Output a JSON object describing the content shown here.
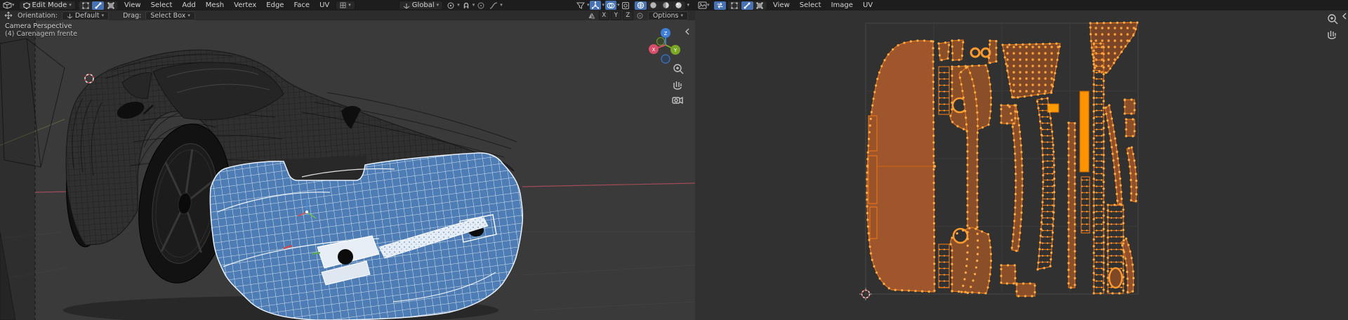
{
  "viewport_3d": {
    "header": {
      "mode_label": "Edit Mode",
      "menus": [
        "View",
        "Select",
        "Add",
        "Mesh",
        "Vertex",
        "Edge",
        "Face",
        "UV"
      ],
      "transform_orientation": "Global"
    },
    "tool_settings": {
      "orientation_label": "Orientation:",
      "orientation_value": "Default",
      "drag_label": "Drag:",
      "drag_value": "Select Box",
      "mirror_x": "X",
      "mirror_y": "Y",
      "mirror_z": "Z",
      "options_label": "Options"
    },
    "overlay": {
      "view_name": "Camera Perspective",
      "object_name": "(4) Carenagem frente"
    },
    "nav_gizmo": {
      "x": "X",
      "y": "Y",
      "z": "Z"
    }
  },
  "uv_editor": {
    "header": {
      "menus": [
        "View",
        "Select",
        "Image",
        "UV"
      ]
    }
  },
  "colors": {
    "accent_blue": "#4772b3",
    "selection_fill": "#4d7db4",
    "uv_orange": "#ff9a2e",
    "uv_island_fill": "#a0562c"
  }
}
